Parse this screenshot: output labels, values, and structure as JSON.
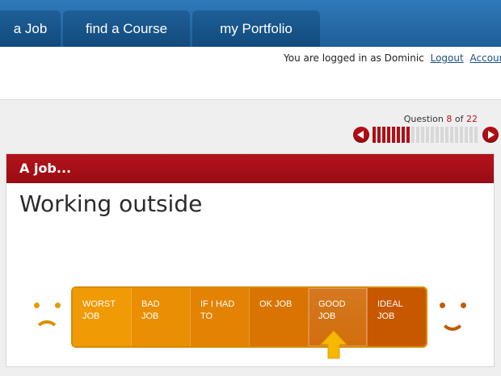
{
  "nav": {
    "tabs": [
      {
        "label": "a Job"
      },
      {
        "label": "find a Course"
      },
      {
        "label": "my Portfolio"
      }
    ]
  },
  "account": {
    "logged_in_text": "You are logged in as Dominic",
    "logout_label": "Logout",
    "account_label": "Account"
  },
  "question": {
    "label_prefix": "Question",
    "current": "8",
    "of_label": "of",
    "total": "22",
    "progress_fraction": 0.364,
    "prev_icon": "arrow-left-icon",
    "next_icon": "arrow-right-icon"
  },
  "card": {
    "header": "A job...",
    "title": "Working outside"
  },
  "rating": {
    "left_icon": "sad-face-icon",
    "right_icon": "happy-face-icon",
    "options": [
      {
        "line1": "WORST",
        "line2": "JOB",
        "color": "#f09a05"
      },
      {
        "line1": "BAD",
        "line2": "JOB",
        "color": "#ea8e04"
      },
      {
        "line1": "IF I HAD",
        "line2": "TO",
        "color": "#e38203"
      },
      {
        "line1": "OK JOB",
        "line2": "",
        "color": "#d97402"
      },
      {
        "line1": "GOOD",
        "line2": "JOB",
        "color": "#cf6601"
      },
      {
        "line1": "IDEAL",
        "line2": "JOB",
        "color": "#c75800"
      }
    ],
    "selected_index": 4,
    "selection_icon": "up-arrow-icon",
    "colors": {
      "arrow": "#f7b800",
      "sad_face": "#e39d00",
      "happy_face": "#c55a00"
    }
  },
  "colors": {
    "nav_blue": "#1d5f98",
    "header_red": "#a50f17"
  }
}
